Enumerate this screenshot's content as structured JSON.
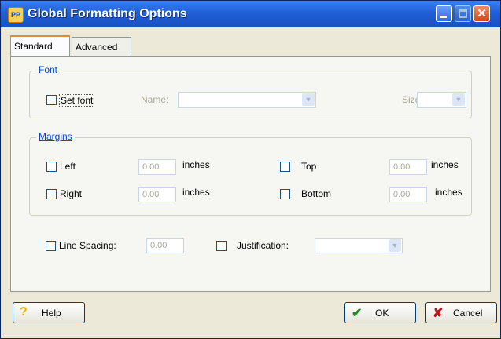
{
  "window": {
    "title": "Global Formatting Options",
    "app_icon": "PP"
  },
  "tabs": [
    {
      "label": "Standard"
    },
    {
      "label": "Advanced"
    }
  ],
  "font_group": {
    "legend": "Font",
    "set_font_label": "Set font",
    "name_label": "Name:",
    "name_value": "",
    "size_label": "Size:",
    "size_value": ""
  },
  "margins_group": {
    "legend": "Margins",
    "left": {
      "label": "Left",
      "value": "0.00",
      "unit": "inches"
    },
    "right": {
      "label": "Right",
      "value": "0.00",
      "unit": "inches"
    },
    "top": {
      "label": "Top",
      "value": "0.00",
      "unit": "inches"
    },
    "bottom": {
      "label": "Bottom",
      "value": "0.00",
      "unit": "inches"
    }
  },
  "line_spacing": {
    "label": "Line Spacing:",
    "value": "0.00"
  },
  "justification": {
    "label": "Justification:",
    "value": ""
  },
  "buttons": {
    "help": "Help",
    "ok": "OK",
    "cancel": "Cancel"
  },
  "colors": {
    "title_bar": "#2a6ad8",
    "accent": "#0046d5",
    "face": "#ece9d8"
  }
}
